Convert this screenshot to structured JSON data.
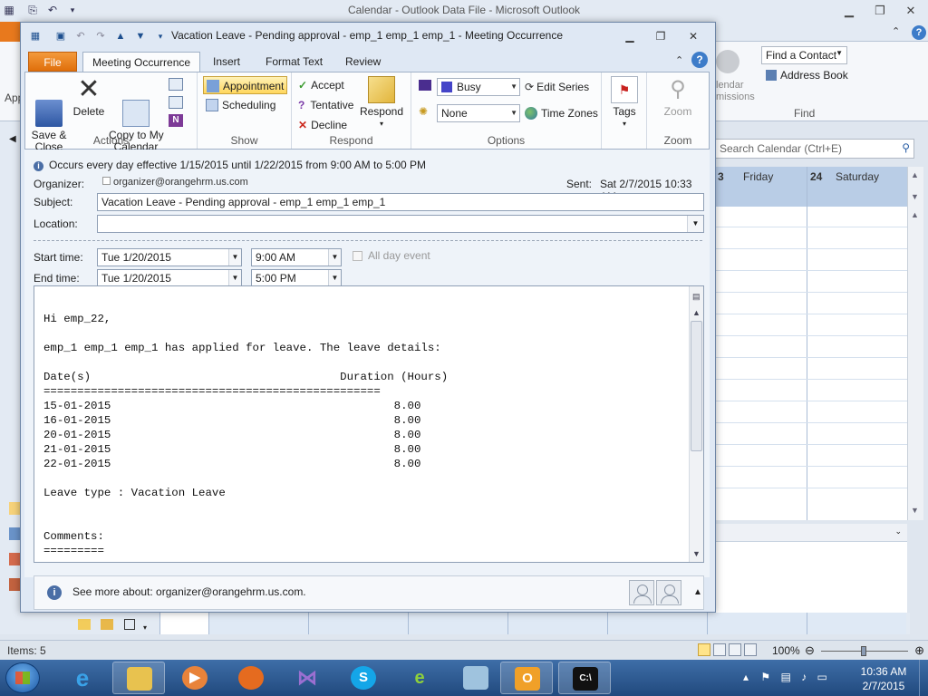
{
  "main": {
    "title": "Calendar - Outlook Data File  -  Microsoft Outlook",
    "file_tab": "F",
    "left_app_label": "App",
    "find_contact": "Find a Contact",
    "address_book": "Address Book",
    "find_group": "Find",
    "calendar_permissions": "lendar\nmissions",
    "search_placeholder": "Search Calendar (Ctrl+E)",
    "days": [
      {
        "num": "3",
        "name": "Friday"
      },
      {
        "num": "24",
        "name": "Saturday"
      }
    ],
    "items_count": "Items: 5",
    "zoom": "100%"
  },
  "meeting": {
    "title": "Vacation Leave - Pending approval - emp_1 emp_1 emp_1  -  Meeting Occurrence",
    "tabs": [
      "File",
      "Meeting Occurrence",
      "Insert",
      "Format Text",
      "Review"
    ],
    "ribbon": {
      "actions": {
        "label": "Actions",
        "save_close": "Save &\nClose",
        "delete": "Delete",
        "copy_calendar": "Copy to My\nCalendar"
      },
      "show": {
        "label": "Show",
        "appointment": "Appointment",
        "scheduling": "Scheduling"
      },
      "respond": {
        "label": "Respond",
        "accept": "Accept",
        "tentative": "Tentative",
        "decline": "Decline",
        "respond": "Respond"
      },
      "options": {
        "label": "Options",
        "show_as": "Busy",
        "reminder": "None",
        "edit_series": "Edit Series",
        "time_zones": "Time Zones"
      },
      "tags": {
        "label": "Tags"
      },
      "zoom": {
        "label": "Zoom",
        "zoom_btn": "Zoom"
      }
    },
    "info": "Occurs every day effective 1/15/2015 until 1/22/2015 from 9:00 AM to 5:00 PM",
    "organizer_label": "Organizer:",
    "organizer": "organizer@orangehrm.us.com",
    "sent_label": "Sent:",
    "sent": "Sat 2/7/2015 10:33 AM",
    "subject_label": "Subject:",
    "subject": "Vacation Leave - Pending approval - emp_1 emp_1 emp_1",
    "location_label": "Location:",
    "location": "",
    "start_label": "Start time:",
    "start_date": "Tue 1/20/2015",
    "start_time": "9:00 AM",
    "end_label": "End time:",
    "end_date": "Tue 1/20/2015",
    "end_time": "5:00 PM",
    "all_day": "All day event",
    "body": "Hi emp_22,\n\nemp_1 emp_1 emp_1 has applied for leave. The leave details:\n\nDate(s)                                     Duration (Hours)\n==================================================\n15-01-2015                                          8.00\n16-01-2015                                          8.00\n20-01-2015                                          8.00\n21-01-2015                                          8.00\n22-01-2015                                          8.00\n\nLeave type : Vacation Leave\n\n\nComments:\n=========",
    "see_more": "See more about: organizer@orangehrm.us.com."
  },
  "taskbar": {
    "clock_time": "10:36 AM",
    "clock_date": "2/7/2015"
  }
}
